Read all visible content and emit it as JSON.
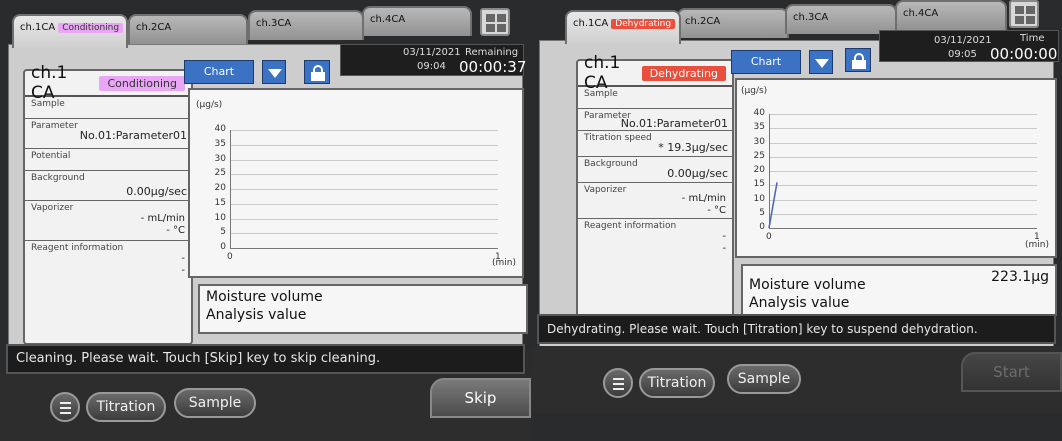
{
  "left": {
    "tabs": [
      {
        "label": "ch.1CA",
        "status": "Conditioning"
      },
      {
        "label": "ch.2CA"
      },
      {
        "label": "ch.3CA"
      },
      {
        "label": "ch.4CA"
      }
    ],
    "channel": "ch.1 CA",
    "channel_status": "Conditioning",
    "view_select": "Chart",
    "date": "03/11/2021",
    "clock": "09:04",
    "time_label": "Remaining",
    "time_value": "00:00:37",
    "fields": {
      "sample": "Sample",
      "parameter_label": "Parameter",
      "parameter_value": "No.01:Parameter01",
      "potential_label": "Potential",
      "background_label": "Background",
      "background_value": "0.00µg/sec",
      "vaporizer_label": "Vaporizer",
      "vaporizer_flow": "- mL/min",
      "vaporizer_temp": "- °C",
      "reagent_label": "Reagent information",
      "reagent_line1": "-",
      "reagent_line2": "-"
    },
    "moisture_label": "Moisture volume",
    "moisture_value": "",
    "analysis_label": "Analysis value",
    "status_message": "Cleaning. Please wait. Touch [Skip] key to skip cleaning.",
    "buttons": {
      "titration": "Titration",
      "sample": "Sample",
      "action": "Skip"
    }
  },
  "right": {
    "tabs": [
      {
        "label": "ch.1CA",
        "status": "Dehydrating"
      },
      {
        "label": "ch.2CA"
      },
      {
        "label": "ch.3CA"
      },
      {
        "label": "ch.4CA"
      }
    ],
    "channel": "ch.1 CA",
    "channel_status": "Dehydrating",
    "view_select": "Chart",
    "date": "03/11/2021",
    "clock": "09:05",
    "time_label": "Time",
    "time_value": "00:00:00",
    "fields": {
      "sample": "Sample",
      "parameter_label": "Parameter",
      "parameter_value": "No.01:Parameter01",
      "titration_speed_label": "Titration speed",
      "titration_speed_value": "* 19.3µg/sec",
      "background_label": "Background",
      "background_value": "0.00µg/sec",
      "vaporizer_label": "Vaporizer",
      "vaporizer_flow": "- mL/min",
      "vaporizer_temp": "- °C",
      "reagent_label": "Reagent information",
      "reagent_line1": "-",
      "reagent_line2": "-"
    },
    "moisture_label": "Moisture volume",
    "moisture_value": "223.1µg",
    "analysis_label": "Analysis value",
    "status_message": "Dehydrating. Please wait. Touch [Titration] key to suspend dehydration.",
    "buttons": {
      "titration": "Titration",
      "sample": "Sample",
      "action": "Start"
    }
  },
  "chart_data": [
    {
      "type": "line",
      "ylabel": "(µg/s)",
      "xlabel": "(min)",
      "yticks": [
        "40",
        "35",
        "30",
        "25",
        "20",
        "15",
        "10",
        "5",
        "0"
      ],
      "xticks": [
        "0",
        "1"
      ],
      "ylim": [
        0,
        40
      ],
      "xlim": [
        0,
        1
      ],
      "series": [
        {
          "x": [],
          "y": []
        }
      ]
    },
    {
      "type": "line",
      "ylabel": "(µg/s)",
      "xlabel": "(min)",
      "yticks": [
        "40",
        "35",
        "30",
        "25",
        "20",
        "15",
        "10",
        "5",
        "0"
      ],
      "xticks": [
        "0",
        "1"
      ],
      "ylim": [
        0,
        40
      ],
      "xlim": [
        0,
        1
      ],
      "series": [
        {
          "x": [
            0,
            0.03
          ],
          "y": [
            0,
            16
          ]
        }
      ]
    }
  ],
  "colors": {
    "conditioning": "#e9a6f4",
    "dehydrating": "#e84f3c",
    "accent": "#3b72c4"
  }
}
